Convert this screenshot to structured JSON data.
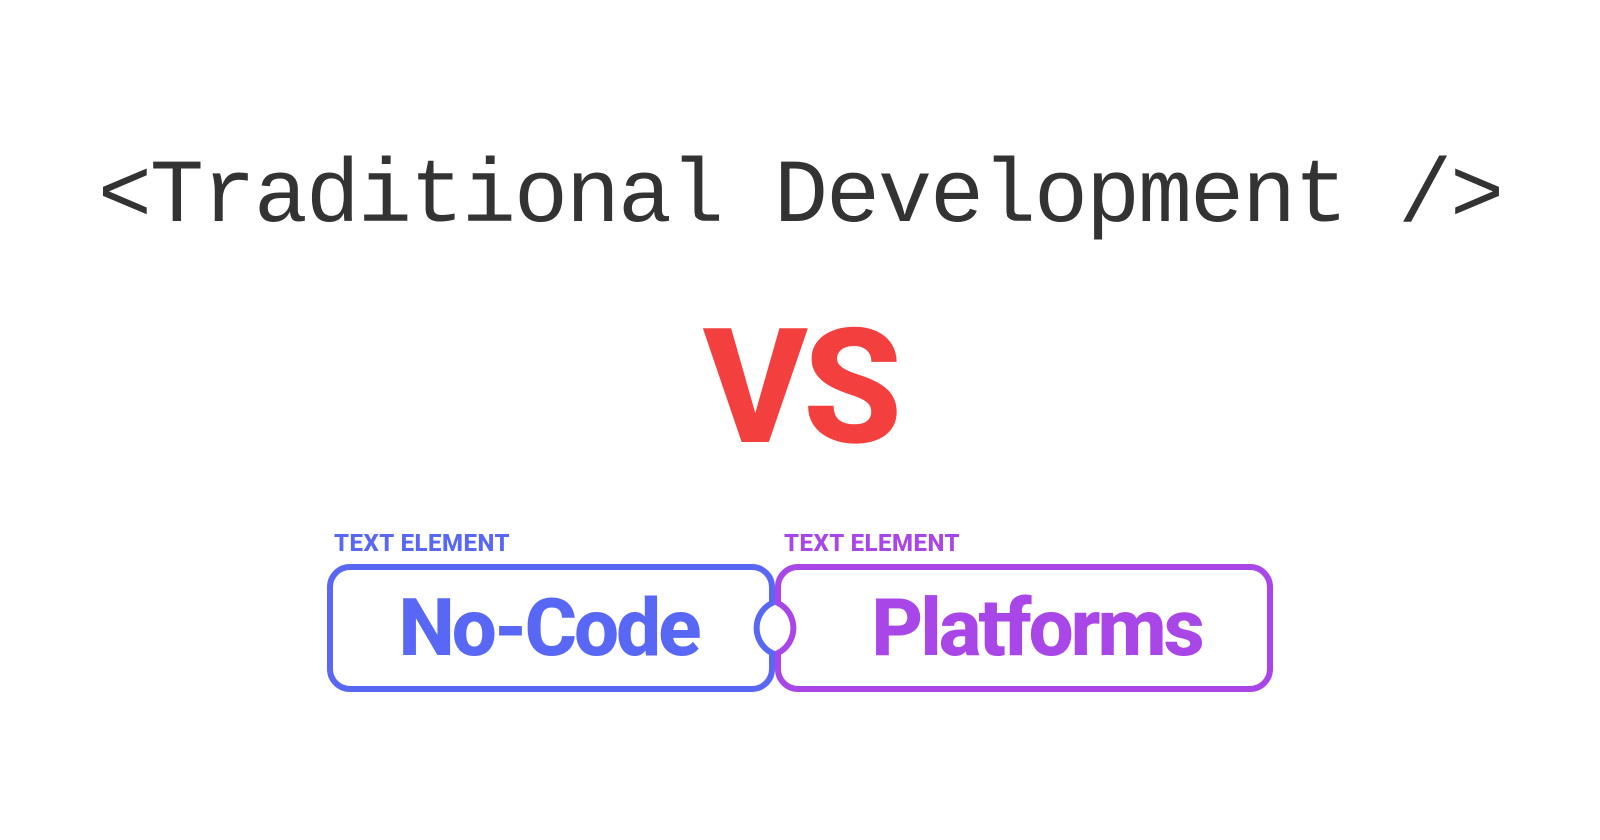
{
  "headline": {
    "code_tag": "<Traditional Development />",
    "vs": "VS"
  },
  "puzzle": {
    "left": {
      "label": "TEXT ELEMENT",
      "text": "No-Code"
    },
    "right": {
      "label": "TEXT ELEMENT",
      "text": "Platforms"
    }
  },
  "colors": {
    "code_gray": "#333333",
    "vs_red": "#f43f3f",
    "blue": "#5868f5",
    "purple": "#a946e8"
  }
}
